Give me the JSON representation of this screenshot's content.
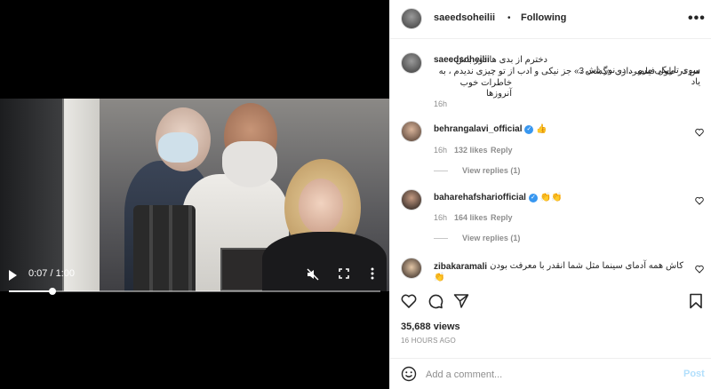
{
  "video": {
    "time_display": "0:07 / 1:00",
    "progress": 0.117,
    "controls": {
      "play": "play-icon",
      "mute": "muted-speaker-icon",
      "fullscreen": "fullscreen-icon",
      "more": "more-vertical-icon"
    }
  },
  "post": {
    "owner": "saeedsoheilii",
    "separator": "•",
    "follow_status": "Following",
    "more": "•••"
  },
  "caption": {
    "user": "saeedsoheilii",
    "line1": "دخترم از بدی ها دور باش ، سوی تاریکی مرو ... در نور باش .",
    "line2": "من در طول فیلمبرداری «گشت 3» جز نیکی و ادب از تو چیزی ندیدم ، به یاد",
    "line3": "خاطرات خوب آنروزها",
    "age": "16h"
  },
  "comments": [
    {
      "user": "behrangalavi_official",
      "verified": true,
      "text": "👍",
      "age": "16h",
      "likes": "132 likes",
      "reply": "Reply",
      "view_replies": "View replies (1)"
    },
    {
      "user": "baharehafshariofficial",
      "verified": true,
      "text": "👏👏",
      "age": "16h",
      "likes": "164 likes",
      "reply": "Reply",
      "view_replies": "View replies (1)"
    },
    {
      "user": "zibakaramali",
      "verified": false,
      "text": "کاش همه آدمای سینما مثل شما انقدر با معرفت بودن",
      "text2": "👏"
    }
  ],
  "stats": {
    "views": "35,688 views",
    "timestamp": "16 HOURS AGO"
  },
  "composer": {
    "placeholder": "Add a comment...",
    "post_label": "Post"
  },
  "colors": {
    "accent": "#3897f0",
    "post_disabled": "#b2dffc",
    "muted_text": "#8e8e8e"
  }
}
